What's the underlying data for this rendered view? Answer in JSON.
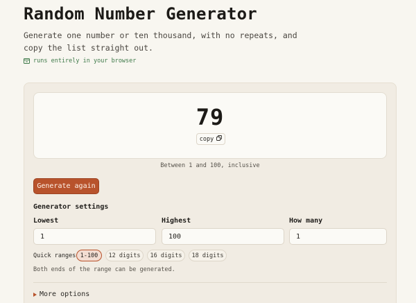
{
  "header": {
    "title": "Random Number Generator",
    "subtitle": "Generate one number or ten thousand, with no repeats, and copy the list straight out.",
    "browser_note": "runs entirely in your browser"
  },
  "result": {
    "number": "79",
    "copy_label": "copy",
    "range_description": "Between 1 and 100, inclusive"
  },
  "actions": {
    "generate_label": "Generate again"
  },
  "settings": {
    "heading": "Generator settings",
    "lowest": {
      "label": "Lowest",
      "value": "1"
    },
    "highest": {
      "label": "Highest",
      "value": "100"
    },
    "how_many": {
      "label": "How many",
      "value": "1"
    },
    "quick_ranges_label": "Quick ranges",
    "quick_ranges": [
      "1-100",
      "12 digits",
      "16 digits",
      "18 digits"
    ],
    "quick_range_selected": "1-100",
    "ends_note": "Both ends of the range can be generated.",
    "more_options_label": "More options"
  },
  "colors": {
    "accent": "#b8532c",
    "browser_note": "#3f7a4a",
    "background": "#f8f6f0",
    "card": "#f1ece3"
  }
}
